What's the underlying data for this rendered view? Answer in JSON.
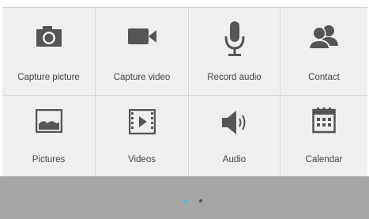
{
  "tiles": [
    {
      "label": "Capture picture",
      "icon": "camera-icon"
    },
    {
      "label": "Capture video",
      "icon": "video-camera-icon"
    },
    {
      "label": "Record audio",
      "icon": "microphone-icon"
    },
    {
      "label": "Contact",
      "icon": "contacts-icon"
    },
    {
      "label": "Pictures",
      "icon": "picture-icon"
    },
    {
      "label": "Videos",
      "icon": "video-file-icon"
    },
    {
      "label": "Audio",
      "icon": "speaker-icon"
    },
    {
      "label": "Calendar",
      "icon": "calendar-icon"
    }
  ],
  "pager": {
    "pages": 2,
    "active_page": 1
  },
  "colors": {
    "tile_background": "#efefef",
    "icon": "#555555",
    "footer": "#a4a6a8",
    "active_dot": "#56b7e6"
  }
}
